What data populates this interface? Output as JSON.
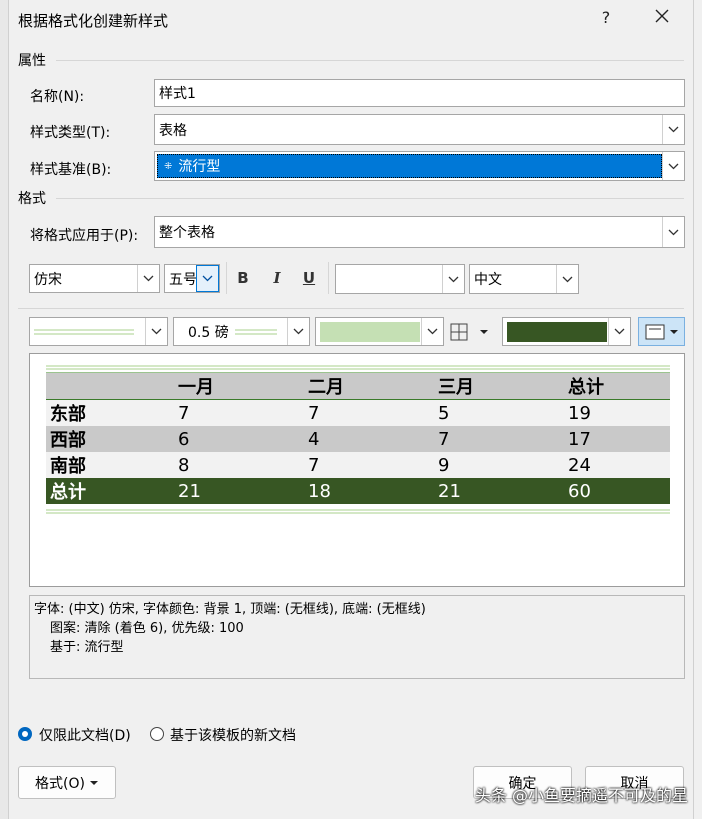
{
  "window": {
    "title": "根据格式化创建新样式",
    "help": "?",
    "close": "✕"
  },
  "properties": {
    "section": "属性",
    "name_label": "名称(N):",
    "name_value": "样式1",
    "type_label": "样式类型(T):",
    "type_value": "表格",
    "base_label": "样式基准(B):",
    "base_value": "流行型"
  },
  "format": {
    "section": "格式",
    "apply_label": "将格式应用于(P):",
    "apply_value": "整个表格",
    "font": "仿宋",
    "size": "五号",
    "bold": "B",
    "italic": "I",
    "underline": "U",
    "font_color": "",
    "language": "中文",
    "line_weight": "0.5 磅",
    "colors": {
      "accent_light": "#c5e0b4",
      "accent_dark": "#375623",
      "line_green": "#a9d18e"
    }
  },
  "preview_table": {
    "headers": [
      "",
      "一月",
      "二月",
      "三月",
      "总计"
    ],
    "rows": [
      [
        "东部",
        "7",
        "7",
        "5",
        "19"
      ],
      [
        "西部",
        "6",
        "4",
        "7",
        "17"
      ],
      [
        "南部",
        "8",
        "7",
        "9",
        "24"
      ],
      [
        "总计",
        "21",
        "18",
        "21",
        "60"
      ]
    ]
  },
  "description": {
    "line1": "字体: (中文) 仿宋, 字体颜色: 背景 1, 顶端: (无框线), 底端: (无框线)",
    "line2": "图案: 清除 (着色 6), 优先级: 100",
    "line3": "基于: 流行型"
  },
  "options": {
    "only_this_doc": "仅限此文档(D)",
    "new_docs": "基于该模板的新文档"
  },
  "buttons": {
    "format": "格式(O)",
    "ok": "确定",
    "cancel": "取消"
  },
  "watermark": "头条 @小鱼要摘遥不可及的星"
}
